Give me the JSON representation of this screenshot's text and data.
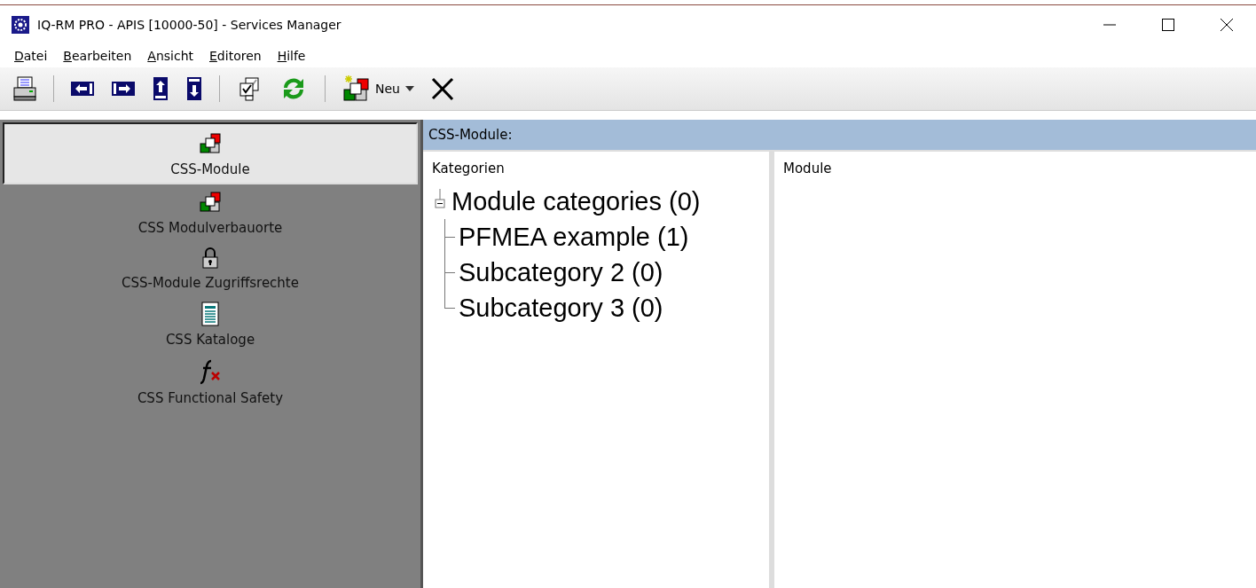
{
  "window": {
    "title": "IQ-RM PRO - APIS [10000-50] - Services Manager"
  },
  "menu": [
    "Datei",
    "Bearbeiten",
    "Ansicht",
    "Editoren",
    "Hilfe"
  ],
  "toolbar": [
    {
      "kind": "print"
    },
    {
      "kind": "sep"
    },
    {
      "kind": "first"
    },
    {
      "kind": "last"
    },
    {
      "kind": "up"
    },
    {
      "kind": "down"
    },
    {
      "kind": "sep"
    },
    {
      "kind": "check"
    },
    {
      "kind": "refresh"
    },
    {
      "kind": "sep"
    },
    {
      "kind": "new",
      "label": "Neu"
    },
    {
      "kind": "delete"
    }
  ],
  "sidebar": {
    "items": [
      {
        "label": "CSS-Module",
        "kind": "modules",
        "selected": true
      },
      {
        "label": "CSS Modulverbauorte",
        "kind": "modules",
        "selected": false
      },
      {
        "label": "CSS-Module Zugriffsrechte",
        "kind": "lock",
        "selected": false
      },
      {
        "label": "CSS Kataloge",
        "kind": "doc",
        "selected": false
      },
      {
        "label": "CSS Functional Safety",
        "kind": "fx",
        "selected": false
      }
    ]
  },
  "panel": {
    "title": "CSS-Module:",
    "categories": {
      "header": "Kategorien",
      "tree": [
        {
          "label": "Module categories (0)",
          "expanded": true,
          "children": [
            {
              "label": "PFMEA example (1)"
            },
            {
              "label": "Subcategory 2 (0)"
            },
            {
              "label": "Subcategory 3 (0)"
            }
          ]
        }
      ]
    },
    "modules": {
      "header": "Module"
    }
  }
}
